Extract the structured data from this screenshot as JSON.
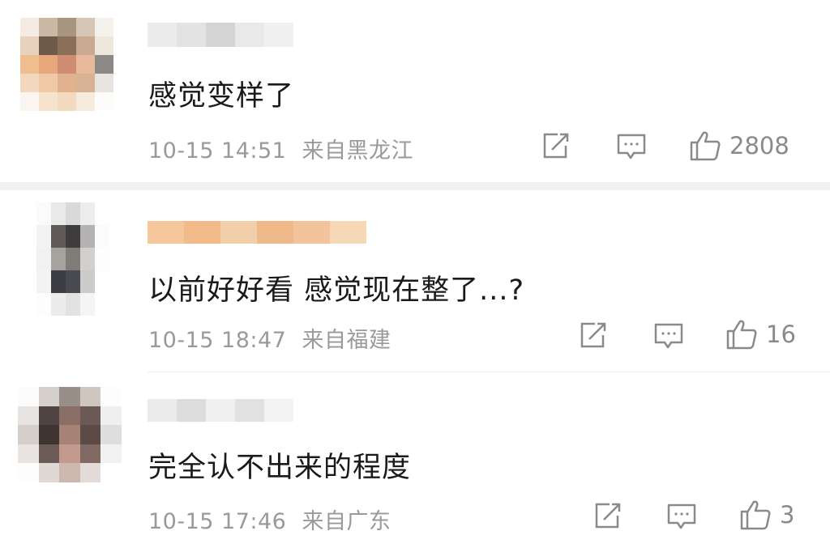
{
  "comments": [
    {
      "text": "感觉变样了",
      "time": "10-15 14:51",
      "location": "来自黑龙江",
      "likes": "2808"
    },
    {
      "text": "以前好好看 感觉现在整了...?",
      "time": "10-15 18:47",
      "location": "来自福建",
      "likes": "16"
    },
    {
      "text": "完全认不出来的程度",
      "time": "10-15 17:46",
      "location": "来自广东",
      "likes": "3"
    }
  ],
  "icons": {
    "share": "share-icon",
    "reply": "comment-icon",
    "like": "thumbs-up-icon"
  },
  "colors": {
    "text": "#1a1a1a",
    "meta": "#9a9a9a",
    "icon": "#8a8a8a",
    "separator": "#f1f1f1"
  }
}
